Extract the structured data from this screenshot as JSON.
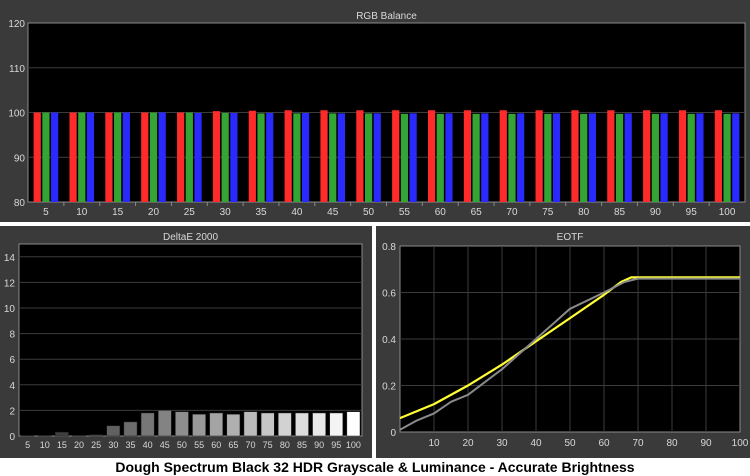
{
  "caption": "Dough Spectrum Black 32 HDR Grayscale & Luminance - Accurate Brightness",
  "colors": {
    "panel_bg": "#3a3a3a",
    "plot_bg": "#000000",
    "grid": "#3c3c3c",
    "red": "#ff2b2b",
    "green": "#34a534",
    "blue": "#2a2aff",
    "target": "#ffff33",
    "measured": "#8a8a8a"
  },
  "chart_data": [
    {
      "type": "bar",
      "title": "RGB Balance",
      "categories": [
        "5",
        "10",
        "15",
        "20",
        "25",
        "30",
        "35",
        "40",
        "45",
        "50",
        "55",
        "60",
        "65",
        "70",
        "75",
        "80",
        "85",
        "90",
        "95",
        "100"
      ],
      "ylim": [
        80,
        120
      ],
      "yticks": [
        80,
        90,
        100,
        110,
        120
      ],
      "series": [
        {
          "values": [
            100,
            100,
            100,
            100,
            100,
            100.3,
            100.4,
            100.5,
            100.5,
            100.5,
            100.5,
            100.5,
            100.5,
            100.5,
            100.5,
            100.5,
            100.5,
            100.5,
            100.5,
            100.5
          ]
        },
        {
          "values": [
            100,
            100,
            100,
            100,
            100,
            99.9,
            99.8,
            99.8,
            99.8,
            99.8,
            99.7,
            99.7,
            99.7,
            99.7,
            99.7,
            99.7,
            99.7,
            99.7,
            99.7,
            99.7
          ]
        },
        {
          "values": [
            100,
            100,
            100,
            100,
            99.9,
            99.9,
            99.9,
            99.9,
            99.8,
            99.8,
            99.8,
            99.8,
            99.8,
            99.8,
            99.8,
            99.8,
            99.8,
            99.8,
            99.8,
            99.8
          ]
        }
      ]
    },
    {
      "type": "bar",
      "title": "DeltaE 2000",
      "categories": [
        "5",
        "10",
        "15",
        "20",
        "25",
        "30",
        "35",
        "40",
        "45",
        "50",
        "55",
        "60",
        "65",
        "70",
        "75",
        "80",
        "85",
        "90",
        "95",
        "100"
      ],
      "values": [
        0.05,
        0.05,
        0.3,
        0.05,
        0.1,
        0.8,
        1.1,
        1.8,
        2.0,
        1.9,
        1.7,
        1.8,
        1.7,
        1.9,
        1.8,
        1.8,
        1.8,
        1.8,
        1.8,
        1.9
      ],
      "ylim": [
        0,
        15
      ],
      "yticks": [
        0,
        2,
        4,
        6,
        8,
        10,
        12,
        14
      ]
    },
    {
      "type": "line",
      "title": "EOTF",
      "xlim": [
        0,
        100
      ],
      "ylim": [
        0,
        0.8
      ],
      "xticks": [
        10,
        20,
        30,
        40,
        50,
        60,
        70,
        80,
        90,
        100
      ],
      "yticks": [
        0,
        0.2,
        0.4,
        0.6,
        0.8
      ],
      "series": [
        {
          "x": [
            0,
            10,
            20,
            30,
            40,
            50,
            60,
            65,
            68,
            70,
            80,
            90,
            100
          ],
          "y": [
            0.06,
            0.12,
            0.2,
            0.29,
            0.39,
            0.49,
            0.59,
            0.645,
            0.665,
            0.665,
            0.665,
            0.665,
            0.665
          ]
        },
        {
          "x": [
            0,
            5,
            10,
            15,
            20,
            30,
            40,
            50,
            60,
            66,
            70,
            80,
            90,
            100
          ],
          "y": [
            0.01,
            0.05,
            0.08,
            0.13,
            0.16,
            0.27,
            0.4,
            0.53,
            0.6,
            0.645,
            0.66,
            0.66,
            0.66,
            0.66
          ]
        }
      ]
    }
  ]
}
